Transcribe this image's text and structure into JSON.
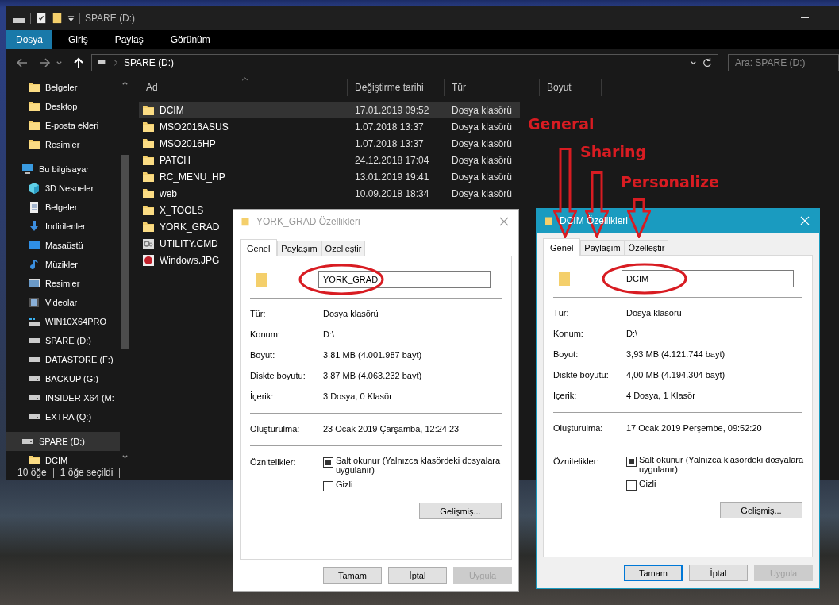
{
  "explorer": {
    "title": "SPARE (D:)",
    "ribbon_tabs": [
      {
        "label": "Dosya",
        "selected": true
      },
      {
        "label": "Giriş",
        "selected": false
      },
      {
        "label": "Paylaş",
        "selected": false
      },
      {
        "label": "Görünüm",
        "selected": false
      }
    ],
    "address": "SPARE (D:)",
    "search": {
      "placeholder": "Ara: SPARE (D:)"
    },
    "sidebar": {
      "quick_access": [
        {
          "label": "Belgeler",
          "kind": "folder"
        },
        {
          "label": "Desktop",
          "kind": "folder"
        },
        {
          "label": "E-posta ekleri",
          "kind": "folder"
        },
        {
          "label": "Resimler",
          "kind": "folder"
        }
      ],
      "items": [
        {
          "label": "Bu bilgisayar",
          "kind": "pc",
          "selected": false,
          "children": [
            {
              "label": "3D Nesneler",
              "kind": "cube",
              "selected": false
            },
            {
              "label": "Belgeler",
              "kind": "document",
              "selected": false
            },
            {
              "label": "İndirilenler",
              "kind": "download",
              "selected": false
            },
            {
              "label": "Masaüstü",
              "kind": "desktop",
              "selected": false
            },
            {
              "label": "Müzikler",
              "kind": "music",
              "selected": false
            },
            {
              "label": "Resimler",
              "kind": "pictures",
              "selected": false
            },
            {
              "label": "Videolar",
              "kind": "video",
              "selected": false
            },
            {
              "label": "WIN10X64PRO",
              "kind": "system_drive",
              "selected": false
            },
            {
              "label": "SPARE (D:)",
              "kind": "drive",
              "selected": false
            },
            {
              "label": "DATASTORE (F:)",
              "kind": "drive",
              "selected": false
            },
            {
              "label": "BACKUP (G:)",
              "kind": "drive",
              "selected": false
            },
            {
              "label": "INSIDER-X64 (M:",
              "kind": "drive",
              "selected": false
            },
            {
              "label": "EXTRA (Q:)",
              "kind": "drive",
              "selected": false
            }
          ]
        },
        {
          "label": "SPARE (D:)",
          "kind": "drive",
          "selected": true,
          "children": [
            {
              "label": "DCIM",
              "kind": "folder",
              "selected": false
            }
          ]
        }
      ]
    },
    "columns": [
      "Ad",
      "Değiştirme tarihi",
      "Tür",
      "Boyut"
    ],
    "rows": [
      {
        "name": "DCIM",
        "date": "17.01.2019 09:52",
        "type": "Dosya klasörü",
        "kind": "folder",
        "selected": true
      },
      {
        "name": "MSO2016ASUS",
        "date": "1.07.2018 13:37",
        "type": "Dosya klasörü",
        "kind": "folder",
        "selected": false
      },
      {
        "name": "MSO2016HP",
        "date": "1.07.2018 13:37",
        "type": "Dosya klasörü",
        "kind": "folder",
        "selected": false
      },
      {
        "name": "PATCH",
        "date": "24.12.2018 17:04",
        "type": "Dosya klasörü",
        "kind": "folder",
        "selected": false
      },
      {
        "name": "RC_MENU_HP",
        "date": "13.01.2019 19:41",
        "type": "Dosya klasörü",
        "kind": "folder",
        "selected": false
      },
      {
        "name": "web",
        "date": "10.09.2018 18:34",
        "type": "Dosya klasörü",
        "kind": "folder",
        "selected": false
      },
      {
        "name": "X_TOOLS",
        "kind": "folder",
        "selected": false
      },
      {
        "name": "YORK_GRAD",
        "kind": "folder",
        "selected": false
      },
      {
        "name": "UTILITY.CMD",
        "kind": "cmd",
        "selected": false
      },
      {
        "name": "Windows.JPG",
        "kind": "image",
        "selected": false
      }
    ],
    "status": [
      "10 öğe",
      "1 öğe seçildi"
    ]
  },
  "dialogs": [
    {
      "title": "YORK_GRAD Özellikleri",
      "active": false,
      "name_circled": true,
      "tabs": [
        {
          "label": "Genel",
          "selected": true
        },
        {
          "label": "Paylaşım",
          "selected": false
        },
        {
          "label": "Özelleştir",
          "selected": false
        }
      ],
      "name_value": "YORK_GRAD",
      "sections": [
        [
          {
            "label": "Tür:",
            "value": "Dosya klasörü"
          },
          {
            "label": "Konum:",
            "value": "D:\\"
          },
          {
            "label": "Boyut:",
            "value": "3,81 MB (4.001.987 bayt)"
          },
          {
            "label": "Diskte boyutu:",
            "value": "3,87 MB (4.063.232 bayt)"
          },
          {
            "label": "İçerik:",
            "value": "3 Dosya, 0 Klasör"
          }
        ],
        [
          {
            "label": "Oluşturulma:",
            "value": "23 Ocak 2019 Çarşamba, 12:24:23"
          }
        ]
      ],
      "attributes_label": "Öznitelikler:",
      "attributes": [
        {
          "label": "Salt okunur (Yalnızca klasördeki dosyalara uygulanır)",
          "checked": true
        },
        {
          "label": "Gizli",
          "checked": false
        }
      ],
      "advanced_button": "Gelişmiş...",
      "buttons": [
        {
          "label": "Tamam",
          "disabled": false,
          "default": false
        },
        {
          "label": "İptal",
          "disabled": false,
          "default": false
        },
        {
          "label": "Uygula",
          "disabled": true,
          "default": false
        }
      ]
    },
    {
      "title": "DCIM Özellikleri",
      "active": true,
      "name_circled": true,
      "tabs": [
        {
          "label": "Genel",
          "selected": true
        },
        {
          "label": "Paylaşım",
          "selected": false
        },
        {
          "label": "Özelleştir",
          "selected": false
        }
      ],
      "name_value": "DCIM",
      "sections": [
        [
          {
            "label": "Tür:",
            "value": "Dosya klasörü"
          },
          {
            "label": "Konum:",
            "value": "D:\\"
          },
          {
            "label": "Boyut:",
            "value": "3,93 MB (4.121.744 bayt)"
          },
          {
            "label": "Diskte boyutu:",
            "value": "4,00 MB (4.194.304 bayt)"
          },
          {
            "label": "İçerik:",
            "value": "4 Dosya, 1 Klasör"
          }
        ],
        [
          {
            "label": "Oluşturulma:",
            "value": "17 Ocak 2019 Perşembe, 09:52:20"
          }
        ]
      ],
      "attributes_label": "Öznitelikler:",
      "attributes": [
        {
          "label": "Salt okunur (Yalnızca klasördeki dosyalara uygulanır)",
          "checked": true
        },
        {
          "label": "Gizli",
          "checked": false
        }
      ],
      "advanced_button": "Gelişmiş...",
      "buttons": [
        {
          "label": "Tamam",
          "disabled": false,
          "default": true
        },
        {
          "label": "İptal",
          "disabled": false,
          "default": false
        },
        {
          "label": "Uygula",
          "disabled": true,
          "default": false
        }
      ]
    }
  ],
  "annotations": [
    "General",
    "Sharing",
    "Personalize"
  ]
}
